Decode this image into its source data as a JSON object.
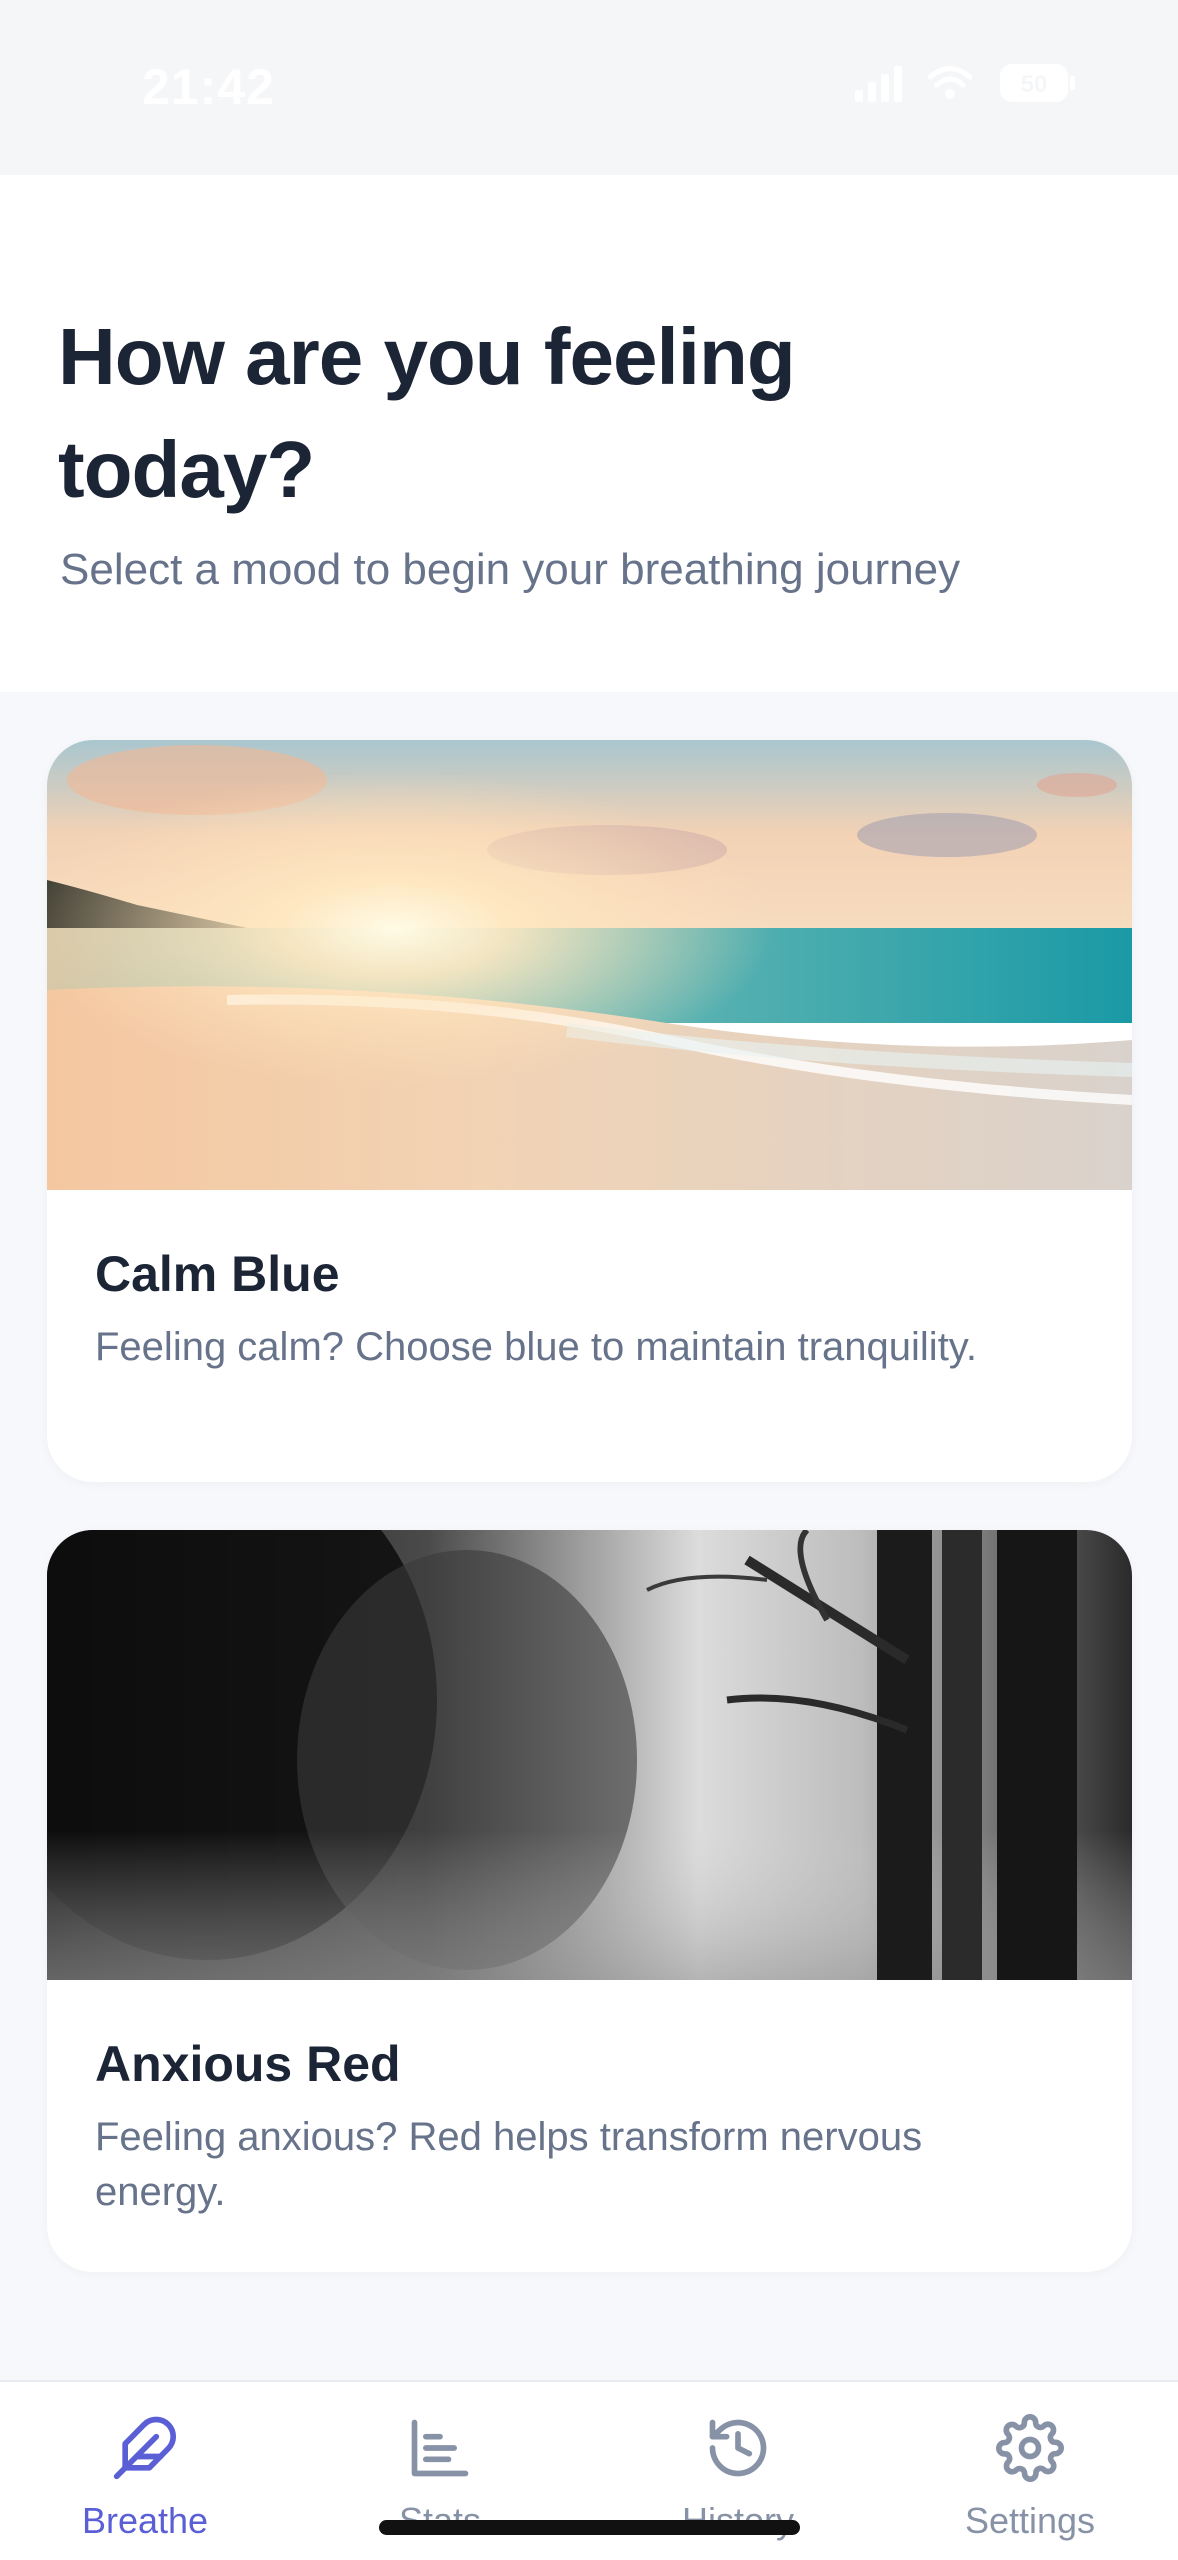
{
  "status_bar": {
    "time": "21:42",
    "battery": "50"
  },
  "header": {
    "title": "How are you feeling today?",
    "subtitle": "Select a mood to begin your breathing journey"
  },
  "moods": [
    {
      "title": "Calm Blue",
      "description": "Feeling calm? Choose blue to maintain tranquility.",
      "image": "sunset-beach-photo"
    },
    {
      "title": "Anxious Red",
      "description": "Feeling anxious? Red helps transform nervous energy.",
      "image": "foggy-forest-photo"
    }
  ],
  "bottom_nav": {
    "items": [
      {
        "label": "Breathe",
        "icon": "feather-icon",
        "active": true
      },
      {
        "label": "Stats",
        "icon": "bar-chart-icon",
        "active": false
      },
      {
        "label": "History",
        "icon": "history-icon",
        "active": false
      },
      {
        "label": "Settings",
        "icon": "gear-icon",
        "active": false
      }
    ]
  },
  "colors": {
    "accent": "#5b5fd6",
    "title_text": "#1c2536",
    "muted_text": "#67738a",
    "nav_inactive": "#8792a6",
    "background": "#f7f8fb"
  }
}
